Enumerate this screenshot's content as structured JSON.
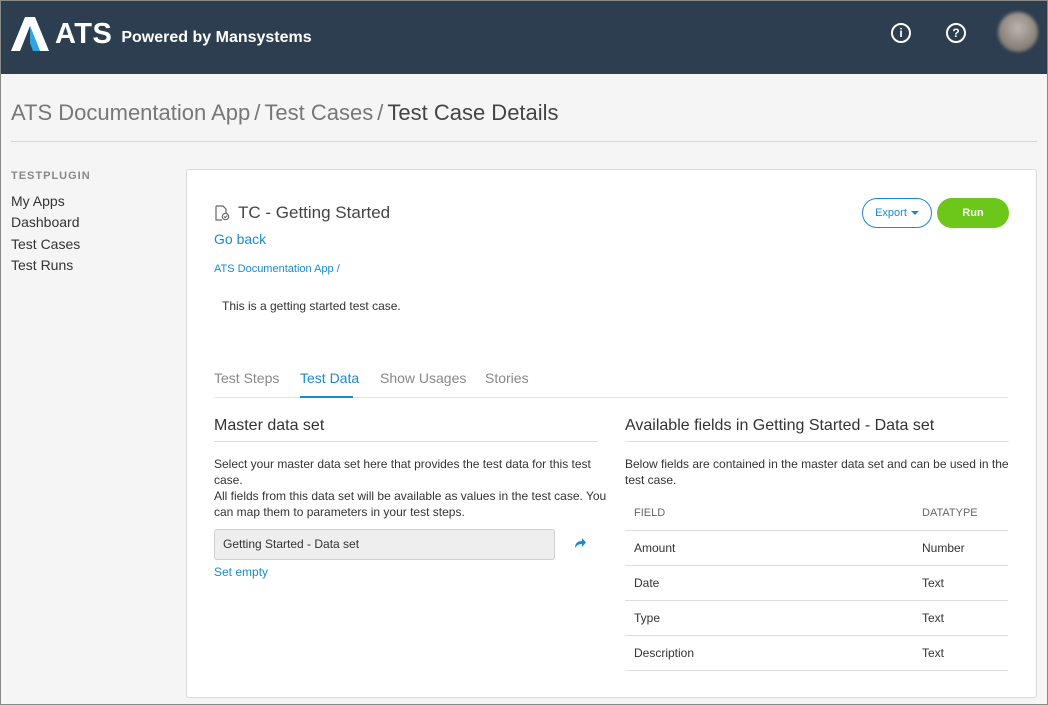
{
  "header": {
    "logo_text": "ATS",
    "logo_subtitle": "Powered by Mansystems",
    "info_icon": "info-circle-icon",
    "help_icon": "help-circle-icon",
    "info_glyph": "i",
    "help_glyph": "?"
  },
  "breadcrumb": {
    "items": [
      "ATS Documentation App",
      "Test Cases",
      "Test Case Details"
    ],
    "separator": "/"
  },
  "sidebar": {
    "title": "TESTPLUGIN",
    "items": [
      "My Apps",
      "Dashboard",
      "Test Cases",
      "Test Runs"
    ]
  },
  "testcase": {
    "title": "TC - Getting Started",
    "go_back": "Go back",
    "app_link": "ATS Documentation App /",
    "description": "This is a getting started test case.",
    "export_label": "Export",
    "run_label": "Run"
  },
  "tabs": [
    "Test Steps",
    "Test Data",
    "Show Usages",
    "Stories"
  ],
  "master": {
    "title": "Master data set",
    "text_line1": "Select your master data set here that provides the test data for this test",
    "text_line2": "case.",
    "text_line3": "All fields from this data set will be available as values in the test case. You",
    "text_line4": "can map them to parameters in your test steps.",
    "dataset_value": "Getting Started - Data set",
    "set_empty": "Set empty"
  },
  "fields": {
    "title": "Available fields in Getting Started - Data set",
    "text_line1": "Below fields are contained in the master data set and can be used in the",
    "text_line2": "test case.",
    "headers": [
      "FIELD",
      "DATATYPE"
    ],
    "rows": [
      {
        "field": "Amount",
        "type": "Number"
      },
      {
        "field": "Date",
        "type": "Text"
      },
      {
        "field": "Type",
        "type": "Text"
      },
      {
        "field": "Description",
        "type": "Text"
      }
    ]
  },
  "colors": {
    "topbar": "#2d3e50",
    "accent": "#1a8ad0",
    "run": "#6dc71a"
  }
}
